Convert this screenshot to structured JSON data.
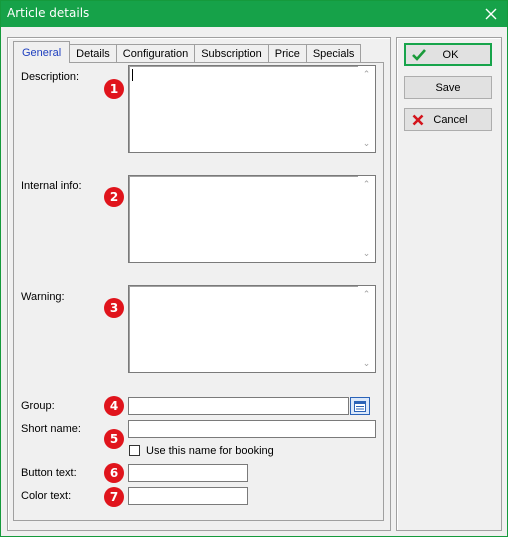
{
  "window": {
    "title": "Article details"
  },
  "tabs": [
    {
      "label": "General",
      "active": true
    },
    {
      "label": "Details",
      "active": false
    },
    {
      "label": "Configuration",
      "active": false
    },
    {
      "label": "Subscription",
      "active": false
    },
    {
      "label": "Price",
      "active": false
    },
    {
      "label": "Specials",
      "active": false
    }
  ],
  "form": {
    "description_label": "Description:",
    "description_value": "",
    "internal_info_label": "Internal info:",
    "internal_info_value": "",
    "warning_label": "Warning:",
    "warning_value": "",
    "group_label": "Group:",
    "group_value": "",
    "short_name_label": "Short name:",
    "short_name_value": "",
    "use_name_checkbox_label": "Use this name for booking",
    "use_name_checked": false,
    "button_text_label": "Button text:",
    "button_text_value": "",
    "color_text_label": "Color text:",
    "color_text_value": ""
  },
  "markers": [
    "1",
    "2",
    "3",
    "4",
    "5",
    "6",
    "7"
  ],
  "buttons": {
    "ok_label": "OK",
    "save_label": "Save",
    "cancel_label": "Cancel"
  },
  "colors": {
    "titlebar": "#16a249",
    "active_tab_text": "#1e3fbf",
    "marker": "#e0141c",
    "ok_check": "#1a9a3a",
    "cancel_x": "#d4141c"
  }
}
